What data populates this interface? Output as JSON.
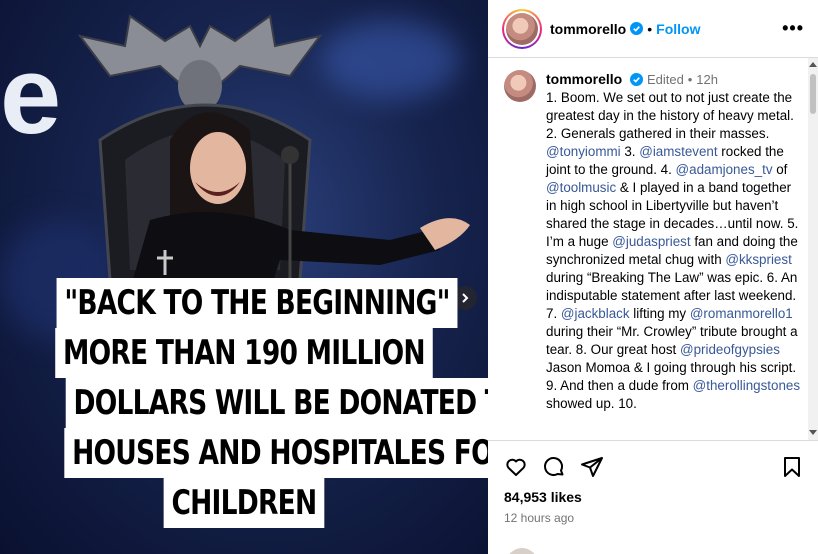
{
  "post": {
    "caption_lines": [
      "\"BACK TO THE BEGINNING\"",
      "MORE THAN 190 MILLION",
      "DOLLARS WILL BE DONATED TO",
      "HOUSES AND HOSPITALES FOR",
      "CHILDREN"
    ],
    "image_letter": "e"
  },
  "header": {
    "username": "tommorello",
    "separator": "•",
    "follow_label": "Follow",
    "more_label": "•••"
  },
  "comment": {
    "username": "tommorello",
    "edited": "Edited",
    "separator": "•",
    "time": "12h",
    "segments": [
      {
        "t": "1. Boom. We set out to not just create the greatest day in the history of heavy metal. 2. Generals gathered in their masses. "
      },
      {
        "m": "@tonyiommi"
      },
      {
        "t": " 3. "
      },
      {
        "m": "@iamstevent"
      },
      {
        "t": " rocked the joint to the ground. 4. "
      },
      {
        "m": "@adamjones_tv"
      },
      {
        "t": " of "
      },
      {
        "m": "@toolmusic"
      },
      {
        "t": " & I played in a band together in high school in Libertyville but haven’t shared the stage in decades…until now. 5. I’m a huge "
      },
      {
        "m": "@judaspriest"
      },
      {
        "t": " fan and doing the synchronized metal chug with "
      },
      {
        "m": "@kkspriest"
      },
      {
        "t": " during “Breaking The Law” was epic. 6. An indisputable statement after last weekend. 7. "
      },
      {
        "m": "@jackblack"
      },
      {
        "t": " lifting my "
      },
      {
        "m": "@romanmorello1"
      },
      {
        "t": " during their “Mr. Crowley” tribute brought a tear. 8. Our great host "
      },
      {
        "m": "@prideofgypsies"
      },
      {
        "t": " Jason Momoa & I going through his script. 9. And then a dude from "
      },
      {
        "m": "@therollingstones"
      },
      {
        "t": " showed up. 10."
      }
    ]
  },
  "footer": {
    "likes": "84,953 likes",
    "time_ago": "12 hours ago"
  },
  "icons": [
    "heart-icon",
    "comment-icon",
    "share-icon",
    "bookmark-icon",
    "verified-icon",
    "chevron-right-icon"
  ],
  "colors": {
    "link": "#0095f6",
    "mention": "#385898",
    "gray": "#737373",
    "media_bg": "#16234d"
  }
}
